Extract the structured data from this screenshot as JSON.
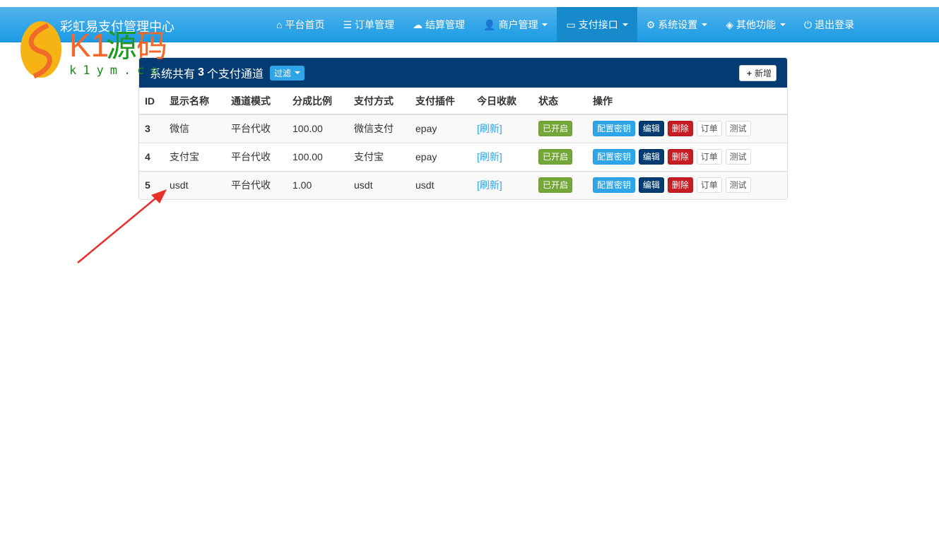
{
  "navbar": {
    "brand": "彩虹易支付管理中心",
    "items": [
      {
        "label": "平台首页",
        "icon": "home-icon",
        "caret": false
      },
      {
        "label": "订单管理",
        "icon": "list-icon",
        "caret": false
      },
      {
        "label": "结算管理",
        "icon": "cloud-icon",
        "caret": false
      },
      {
        "label": "商户管理",
        "icon": "user-icon",
        "caret": true
      },
      {
        "label": "支付接口",
        "icon": "credit-card-icon",
        "caret": true,
        "active": true
      },
      {
        "label": "系统设置",
        "icon": "gear-icon",
        "caret": true
      },
      {
        "label": "其他功能",
        "icon": "box-icon",
        "caret": true
      },
      {
        "label": "退出登录",
        "icon": "power-icon",
        "caret": false
      }
    ]
  },
  "watermark": {
    "text": "K1源码",
    "url": "k1ym.com"
  },
  "panel": {
    "title_prefix": "系统共有",
    "count": "3",
    "title_suffix": "个支付通道",
    "filter": "过滤",
    "add": "新增"
  },
  "table": {
    "headers": [
      "ID",
      "显示名称",
      "通道模式",
      "分成比例",
      "支付方式",
      "支付插件",
      "今日收款",
      "状态",
      "操作"
    ],
    "rows": [
      {
        "id": "3",
        "name": "微信",
        "mode": "平台代收",
        "rate": "100.00",
        "method": "微信支付",
        "plugin": "epay",
        "today": "[刷新]",
        "status": "已开启"
      },
      {
        "id": "4",
        "name": "支付宝",
        "mode": "平台代收",
        "rate": "100.00",
        "method": "支付宝",
        "plugin": "epay",
        "today": "[刷新]",
        "status": "已开启"
      },
      {
        "id": "5",
        "name": "usdt",
        "mode": "平台代收",
        "rate": "1.00",
        "method": "usdt",
        "plugin": "usdt",
        "today": "[刷新]",
        "status": "已开启"
      }
    ],
    "actions": [
      "配置密钥",
      "编辑",
      "删除",
      "订单",
      "测试"
    ]
  }
}
